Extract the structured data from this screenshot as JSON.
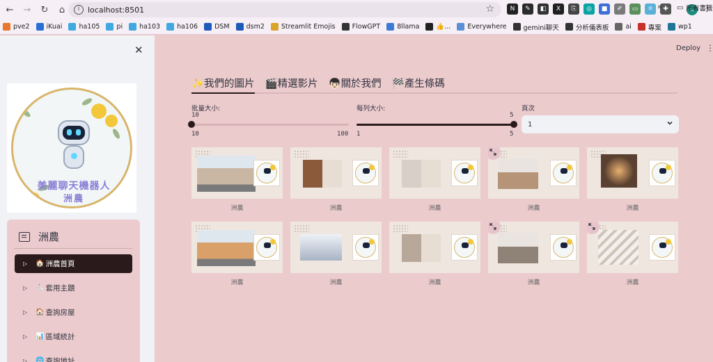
{
  "browser": {
    "url": "localhost:8501",
    "profile_initial": "L",
    "extensions": [
      {
        "name": "notion-ext",
        "glyph": "N",
        "color": "#222222"
      },
      {
        "name": "docs-ext",
        "glyph": "✎",
        "color": "#2b2b2b"
      },
      {
        "name": "tab-ext",
        "glyph": "◧",
        "color": "#333333"
      },
      {
        "name": "x-ext",
        "glyph": "X",
        "color": "#1f1f1f"
      },
      {
        "name": "copy-ext",
        "glyph": "⎘",
        "color": "#444444"
      },
      {
        "name": "lens-ext",
        "glyph": "◎",
        "color": "#0aa3a3"
      },
      {
        "name": "note-ext",
        "glyph": "■",
        "color": "#3d6fd6"
      },
      {
        "name": "pen-ext",
        "glyph": "✐",
        "color": "#7a7a7a"
      },
      {
        "name": "chat-ext",
        "glyph": "▭",
        "color": "#5b8f5b"
      },
      {
        "name": "react-ext",
        "glyph": "⚛",
        "color": "#5ab0d6"
      },
      {
        "name": "puzzle-ext",
        "glyph": "✚",
        "color": "#555555"
      }
    ],
    "bookmarks": [
      {
        "label": "pve2",
        "color": "#e8762b"
      },
      {
        "label": "iKuai",
        "color": "#2a6fd6"
      },
      {
        "label": "ha105",
        "color": "#3fa9e0"
      },
      {
        "label": "pi",
        "color": "#3fa9e0"
      },
      {
        "label": "ha103",
        "color": "#3fa9e0"
      },
      {
        "label": "ha106",
        "color": "#3fa9e0"
      },
      {
        "label": "DSM",
        "color": "#1e5bb8"
      },
      {
        "label": "dsm2",
        "color": "#1e5bb8"
      },
      {
        "label": "Streamlit Emojis",
        "color": "#d8a42a"
      },
      {
        "label": "FlowGPT",
        "color": "#333333"
      },
      {
        "label": "8llama",
        "color": "#3b7bd6"
      },
      {
        "label": "👍...",
        "color": "#222222"
      },
      {
        "label": "Everywhere",
        "color": "#5b8fd6"
      },
      {
        "label": "gemini聊天",
        "color": "#333333"
      },
      {
        "label": "分析儀表板",
        "color": "#333333"
      },
      {
        "label": "ai",
        "color": "#666666"
      },
      {
        "label": "專案",
        "color": "#c8302a"
      },
      {
        "label": "wp1",
        "color": "#21759b"
      }
    ],
    "bookmarks_more": "»",
    "bookmarks_folder": "所有書籤"
  },
  "sidebar": {
    "logo_text_line1": "美麗聊天機器人",
    "logo_text_line2": "洲農",
    "menu_title": "洲農",
    "items": [
      {
        "emoji": "🏠",
        "label": "洲農首頁",
        "active": true
      },
      {
        "emoji": "🐇",
        "label": "套用主題",
        "active": false
      },
      {
        "emoji": "🏠",
        "label": "查詢房屋",
        "active": false
      },
      {
        "emoji": "📊",
        "label": "區域統計",
        "active": false
      },
      {
        "emoji": "🌐",
        "label": "查詢地址",
        "active": false
      }
    ]
  },
  "header": {
    "deploy_label": "Deploy"
  },
  "tabs": [
    {
      "label": "✨我們的圖片",
      "active": true
    },
    {
      "label": "🎬精選影片",
      "active": false
    },
    {
      "label": "👦🏻關於我們",
      "active": false
    },
    {
      "label": "🏁產生條碼",
      "active": false
    }
  ],
  "controls": {
    "batch_size": {
      "label": "批量大小:",
      "value": 10,
      "min": 10,
      "max": 100
    },
    "row_size": {
      "label": "每列大小:",
      "value": 5,
      "min": 1,
      "max": 5
    },
    "page": {
      "label": "頁次",
      "value": "1"
    }
  },
  "gallery": {
    "caption": "洲農",
    "images": [
      {
        "photo_color": "#c9b7a4",
        "photo_shape": "house",
        "expand": false
      },
      {
        "photo_color": "#8a5a3a",
        "photo_shape": "room",
        "expand": false
      },
      {
        "photo_color": "#d8cfc8",
        "photo_shape": "room",
        "expand": false
      },
      {
        "photo_color": "#b59478",
        "photo_shape": "kitchen",
        "expand": true
      },
      {
        "photo_color": "#5a4030",
        "photo_shape": "hall",
        "expand": false
      },
      {
        "photo_color": "#d9a06a",
        "photo_shape": "house",
        "expand": false
      },
      {
        "photo_color": "#a8b3c4",
        "photo_shape": "search",
        "expand": false
      },
      {
        "photo_color": "#b8a89a",
        "photo_shape": "room",
        "expand": false
      },
      {
        "photo_color": "#8f8378",
        "photo_shape": "kitchen",
        "expand": true
      },
      {
        "photo_color": "#cfc4ba",
        "photo_shape": "stairs",
        "expand": true
      }
    ]
  }
}
